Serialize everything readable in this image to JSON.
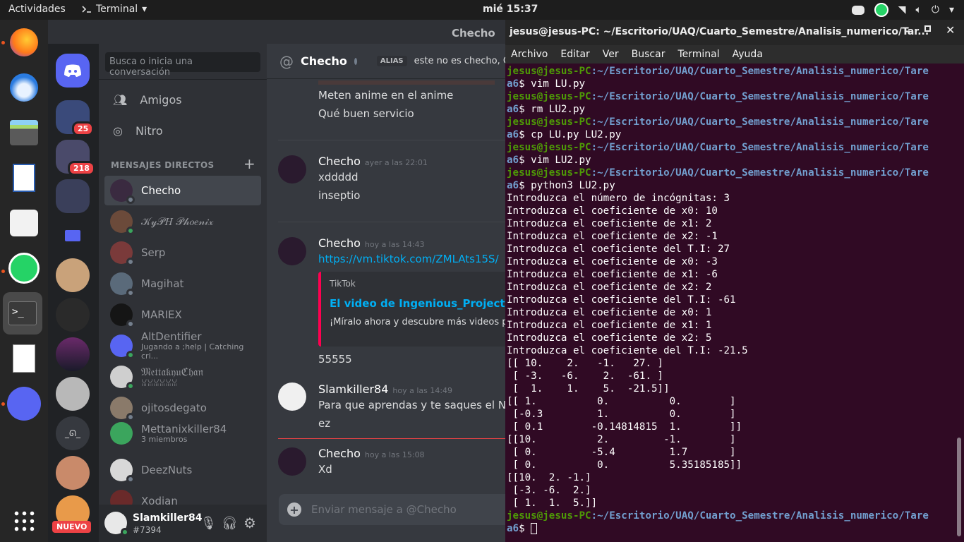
{
  "topbar": {
    "activities": "Actividades",
    "app": "Terminal",
    "clock": "mié 15:37"
  },
  "discord": {
    "window_title": "Checho",
    "search_placeholder": "Busca o inicia una conversación",
    "nav": {
      "friends": "Amigos",
      "nitro": "Nitro"
    },
    "dm_header": "MENSAJES DIRECTOS",
    "dms": [
      {
        "name": "Checho",
        "sub": "",
        "status": "offline",
        "color": "#3a2a40"
      },
      {
        "name": "𝒦𝓎𝒫𝐻 𝒫𝒽𝑜𝑒𝓃𝒾𝓍",
        "sub": "",
        "status": "online",
        "color": "#6b4a3a"
      },
      {
        "name": "Serp",
        "sub": "",
        "status": "offline",
        "color": "#7a3a3a"
      },
      {
        "name": "Magihat",
        "sub": "",
        "status": "offline",
        "color": "#5a6a7a"
      },
      {
        "name": "MARIEX",
        "sub": "",
        "status": "offline",
        "color": "#151515"
      },
      {
        "name": "AltDentifier",
        "sub": "Jugando a ;help | Catching cri...",
        "status": "online",
        "color": "#5865f2"
      },
      {
        "name": "𝔐𝔢𝔱𝔱𝔞𝔨𝔶𝔲ℭ𝔥𝔞𝔫",
        "sub": "ꈍꈍꈍꈍꈍꈍ",
        "status": "online",
        "color": "#cfcfcf"
      },
      {
        "name": "ojitosdegato",
        "sub": "",
        "status": "offline",
        "color": "#8a7a6a"
      },
      {
        "name": "Mettanixkiller84",
        "sub": "3 miembros",
        "status": "none",
        "color": "#3ba55d"
      },
      {
        "name": "DeezNuts",
        "sub": "",
        "status": "offline",
        "color": "#d8d8d8"
      },
      {
        "name": "Xodian",
        "sub": "",
        "status": "offline",
        "color": "#6a2a2a"
      }
    ],
    "user": {
      "name": "Slamkiller84",
      "tag": "#7394"
    },
    "server_badges": [
      "25",
      "218"
    ],
    "new_badge": "NUEVO",
    "chat": {
      "header_name": "Checho",
      "alias_label": "ALIAS",
      "alias_text": "este no es checho, CH",
      "top_lines": [
        "Meten anime en el anime",
        "Qué buen servicio"
      ],
      "messages": [
        {
          "author": "Checho",
          "time": "ayer a las 22:01",
          "lines": [
            "xddddd",
            "inseptio"
          ]
        },
        {
          "author": "Checho",
          "time": "hoy a las 14:43",
          "lines": [
            "https://vm.tiktok.com/ZMLAts15S/"
          ]
        },
        {
          "author": "Slamkiller84",
          "time": "hoy a las 14:49",
          "lines": [
            "Para que aprendas y te saques el Nobel",
            "ez"
          ]
        },
        {
          "author": "Checho",
          "time": "hoy a las 15:08",
          "lines": [
            "Xd"
          ]
        }
      ],
      "embed": {
        "provider": "TikTok",
        "title": "El video de Ingenious_Project en TikT",
        "desc": "¡Míralo ahora y descubre más videos popul"
      },
      "after_embed": "55555",
      "input_placeholder": "Enviar mensaje a @Checho"
    }
  },
  "terminal": {
    "title": "jesus@jesus-PC: ~/Escritorio/UAQ/Cuarto_Semestre/Analisis_numerico/Tar...",
    "menu": [
      "Archivo",
      "Editar",
      "Ver",
      "Buscar",
      "Terminal",
      "Ayuda"
    ],
    "prompt_user": "jesus@jesus-PC",
    "prompt_path": ":~/Escritorio/UAQ/Cuarto_Semestre/Analisis_numerico/Tare",
    "prompt_cont": "a6",
    "commands": [
      "vim LU.py",
      "rm LU2.py",
      "cp LU.py LU2.py",
      "vim LU2.py",
      "python3 LU2.py"
    ],
    "output": [
      "Introduzca el número de incógnitas: 3",
      "Introduzca el coeficiente de x0: 10",
      "Introduzca el coeficiente de x1: 2",
      "Introduzca el coeficiente de x2: -1",
      "Introduzca el coeficiente del T.I: 27",
      "Introduzca el coeficiente de x0: -3",
      "Introduzca el coeficiente de x1: -6",
      "Introduzca el coeficiente de x2: 2",
      "Introduzca el coeficiente del T.I: -61",
      "Introduzca el coeficiente de x0: 1",
      "Introduzca el coeficiente de x1: 1",
      "Introduzca el coeficiente de x2: 5",
      "Introduzca el coeficiente del T.I: -21.5",
      "[[ 10.    2.   -1.   27. ]",
      " [ -3.   -6.    2.  -61. ]",
      " [  1.    1.    5.  -21.5]]",
      "[[ 1.          0.          0.        ]",
      " [-0.3         1.          0.        ]",
      " [ 0.1        -0.14814815  1.        ]]",
      "[[10.          2.         -1.        ]",
      " [ 0.         -5.4         1.7       ]",
      " [ 0.          0.          5.35185185]]",
      "[[10.  2. -1.]",
      " [-3. -6.  2.]",
      " [ 1.  1.  5.]]"
    ]
  }
}
